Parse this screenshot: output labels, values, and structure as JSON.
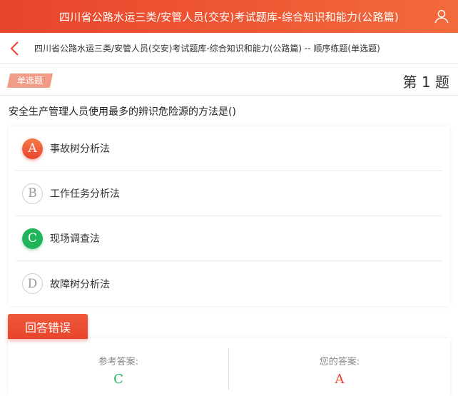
{
  "header": {
    "title": "四川省公路水运三类/安管人员(交安)考试题库-综合知识和能力(公路篇)",
    "user_icon": "user-icon"
  },
  "breadcrumb": {
    "text": "四川省公路水运三类/安管人员(交安)考试题库-综合知识和能力(公路篇) -- 顺序练题(单选题)",
    "back_icon": "chevron-left-icon"
  },
  "question": {
    "type_badge": "单选题",
    "number_label": "第 1 题",
    "text": "安全生产管理人员使用最多的辨识危险源的方法是()",
    "options": [
      {
        "letter": "A",
        "text": "事故树分析法",
        "state": "wrong-selected"
      },
      {
        "letter": "B",
        "text": "工作任务分析法",
        "state": "normal"
      },
      {
        "letter": "C",
        "text": "现场调查法",
        "state": "correct"
      },
      {
        "letter": "D",
        "text": "故障树分析法",
        "state": "normal"
      }
    ]
  },
  "result": {
    "status_label": "回答错误",
    "reference_label": "参考答案:",
    "reference_answer": "C",
    "your_label": "您的答案:",
    "your_answer": "A"
  },
  "colors": {
    "accent": "#e8452c",
    "correct": "#21b45a",
    "badge": "#f19c86"
  }
}
